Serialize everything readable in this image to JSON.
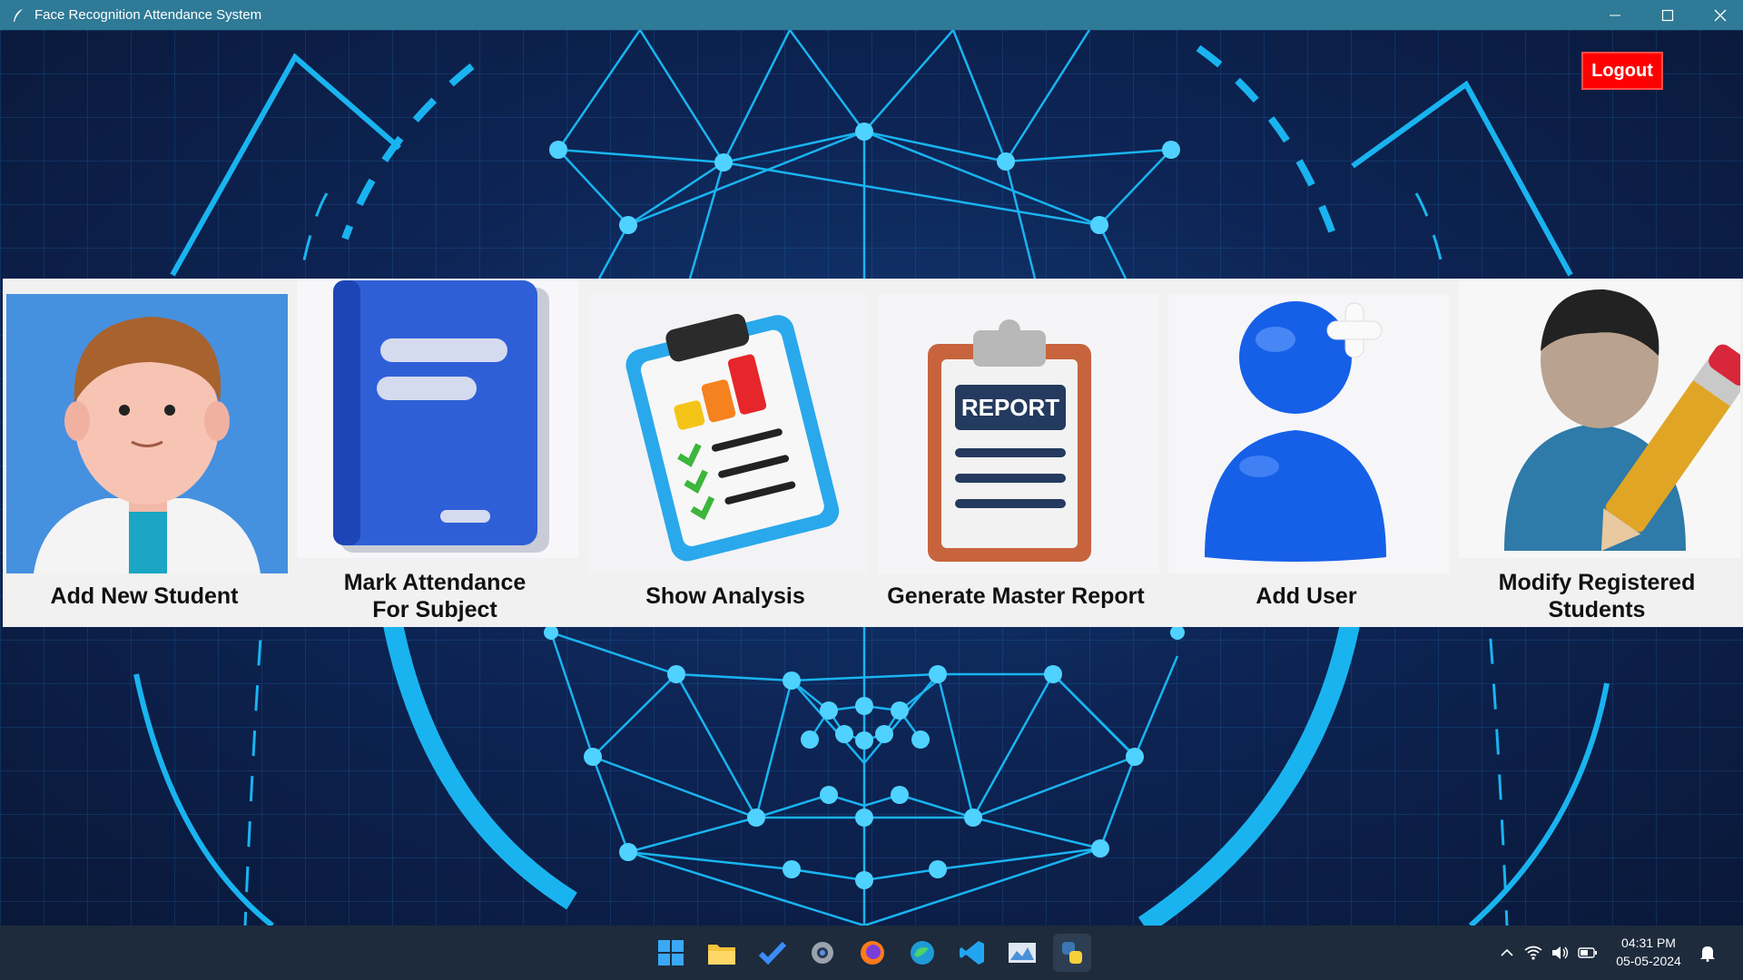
{
  "window": {
    "title": "Face Recognition Attendance System",
    "controls": [
      "minimize-icon",
      "maximize-icon",
      "close-icon"
    ]
  },
  "header": {
    "logout_label": "Logout"
  },
  "tiles": [
    {
      "label_line1": "Add New Student",
      "label_line2": "",
      "icon": "student-avatar-icon"
    },
    {
      "label_line1": "Mark Attendance",
      "label_line2": "For Subject",
      "icon": "book-icon"
    },
    {
      "label_line1": "Show Analysis",
      "label_line2": "",
      "icon": "clipboard-chart-icon"
    },
    {
      "label_line1": "Generate Master Report",
      "label_line2": "",
      "icon": "report-clipboard-icon",
      "badge": "REPORT"
    },
    {
      "label_line1": "Add User",
      "label_line2": "",
      "icon": "add-user-icon"
    },
    {
      "label_line1": "Modify Registered",
      "label_line2": "Students",
      "icon": "edit-user-icon"
    }
  ],
  "taskbar": {
    "apps": [
      "windows-start-icon",
      "file-explorer-icon",
      "todo-icon",
      "settings-icon",
      "firefox-icon",
      "edge-icon",
      "vscode-icon",
      "photos-icon",
      "python-icon"
    ],
    "tray": [
      "chevron-up-icon",
      "wifi-icon",
      "volume-icon",
      "battery-icon",
      "notification-bell-icon"
    ],
    "time": "04:31 PM",
    "date": "05-05-2024"
  },
  "colors": {
    "titlebar": "#2f7a96",
    "logout": "#ff0000",
    "accent_cyan": "#19b4f0",
    "taskbar": "#1d2b3c"
  }
}
